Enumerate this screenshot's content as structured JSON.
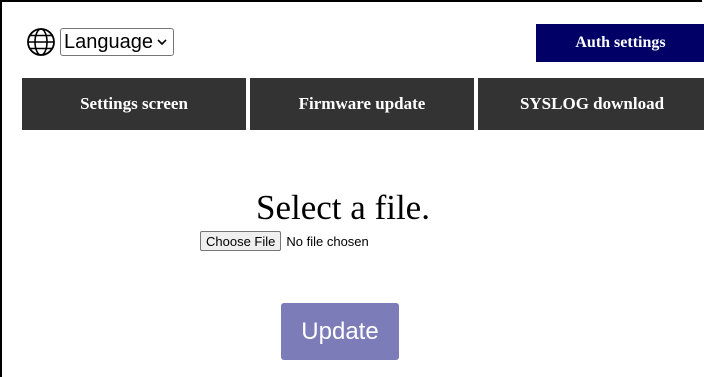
{
  "header": {
    "globe_icon": "globe-icon",
    "language_select": {
      "selected": "Language",
      "chevron_icon": "chevron-down-icon"
    },
    "auth_button_label": "Auth settings",
    "auth_button_color": "#000066"
  },
  "nav": {
    "tab_color": "#333333",
    "tabs": [
      {
        "label": "Settings screen"
      },
      {
        "label": "Firmware update"
      },
      {
        "label": "SYSLOG download"
      }
    ]
  },
  "main": {
    "title": "Select a file.",
    "file_input": {
      "button_label": "Choose File",
      "status": "No file chosen"
    },
    "update_button_label": "Update",
    "update_button_color": "#7c7cb9"
  }
}
